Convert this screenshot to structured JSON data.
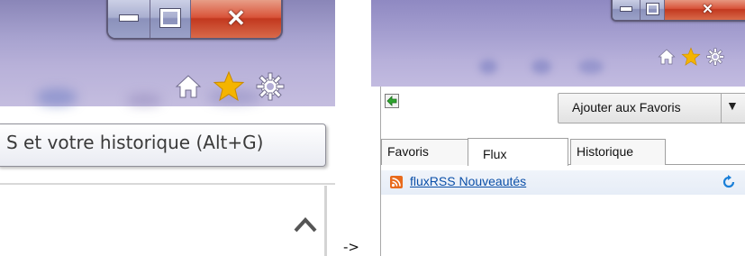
{
  "left": {
    "window_buttons": {
      "minimize": "minimize",
      "restore": "restore",
      "close": "close"
    },
    "toolbar_icons": [
      "home-icon",
      "star-icon",
      "gear-icon"
    ],
    "tooltip_text": "S et votre historique (Alt+G)"
  },
  "arrow": "->",
  "right": {
    "window_buttons": {
      "minimize": "minimize",
      "restore": "restore",
      "close": "close"
    },
    "toolbar_icons": [
      "home-icon",
      "star-icon",
      "gear-icon"
    ],
    "add_favorites_label": "Ajouter aux Favoris",
    "tabs": [
      {
        "label": "Favoris",
        "selected": false
      },
      {
        "label": "Flux",
        "selected": true
      },
      {
        "label": "Historique",
        "selected": false
      }
    ],
    "feed_item": "fluxRSS Nouveautés"
  },
  "colors": {
    "chrome_top": "#8a86b8",
    "chrome_bottom": "#c4bddf",
    "close_red": "#c2381f",
    "star_gold": "#f4b400",
    "link_blue": "#0b4fa8",
    "rss_orange": "#e86a1c"
  }
}
